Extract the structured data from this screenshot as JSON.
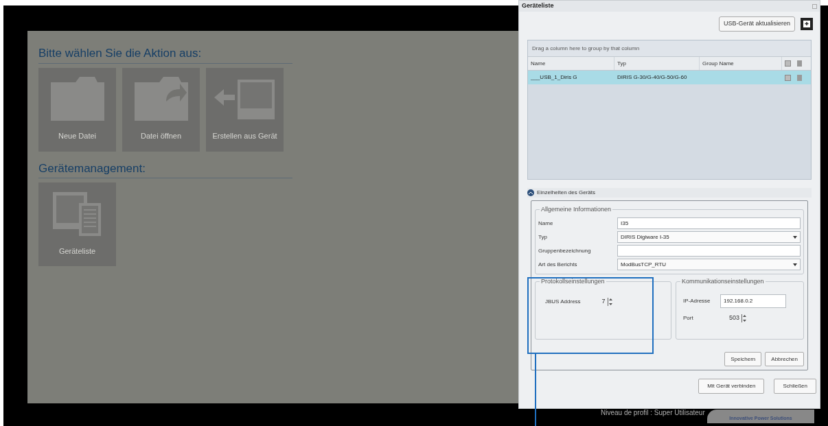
{
  "main": {
    "sections": [
      {
        "heading": "Bitte wählen Sie die Aktion aus:",
        "tiles": [
          {
            "kind": "new-file",
            "label": "Neue Datei"
          },
          {
            "kind": "open-file",
            "label": "Datei öffnen"
          },
          {
            "kind": "from-device",
            "label": "Erstellen aus Gerät"
          }
        ]
      },
      {
        "heading": "Gerätemanagement:",
        "tiles": [
          {
            "kind": "device-list",
            "label": "Geräteliste"
          }
        ]
      }
    ]
  },
  "footer": {
    "profile": "Niveau de profil : Super Utilisateur",
    "logo_tagline": "Innovative Power Solutions"
  },
  "dialog": {
    "title": "Geräteliste",
    "refresh_button": "USB-Gerät aktualisieren",
    "grid": {
      "group_hint": "Drag a column here to group by that column",
      "columns": [
        "Name",
        "Typ",
        "Group Name"
      ],
      "rows": [
        {
          "cells": [
            "___USB_1_Diris G",
            "DIRIS G-30/G-40/G-50/G-60",
            ""
          ],
          "selected": true
        }
      ]
    },
    "details": {
      "title": "Einzelheiten des Geräts",
      "expanded": true,
      "general": {
        "title": "Allgemeine Informationen",
        "fields": [
          {
            "label": "Name",
            "value": "I35",
            "kind": "text"
          },
          {
            "label": "Typ",
            "value": "DIRIS Digiware I-35",
            "kind": "select"
          },
          {
            "label": "Gruppenbezeichnung",
            "kind": "text"
          },
          {
            "label": "Art des Berichts",
            "value": "ModBusTCP_RTU",
            "kind": "select"
          }
        ]
      },
      "protocol": {
        "title": "Protokollseinstellungen",
        "fields": [
          {
            "label": "JBUS Address",
            "value": "7",
            "kind": "spinner"
          }
        ]
      },
      "communication": {
        "title": "Kommunikationseinstellungen",
        "fields": [
          {
            "label": "IP-Adresse",
            "value": "192.168.0.2",
            "kind": "text"
          },
          {
            "label": "Port",
            "value": "503",
            "kind": "spinner"
          }
        ]
      },
      "buttons": [
        "Speichern",
        "Abbrechen"
      ]
    },
    "buttons": [
      "Mit Gerät verbinden",
      "Schließen"
    ]
  }
}
